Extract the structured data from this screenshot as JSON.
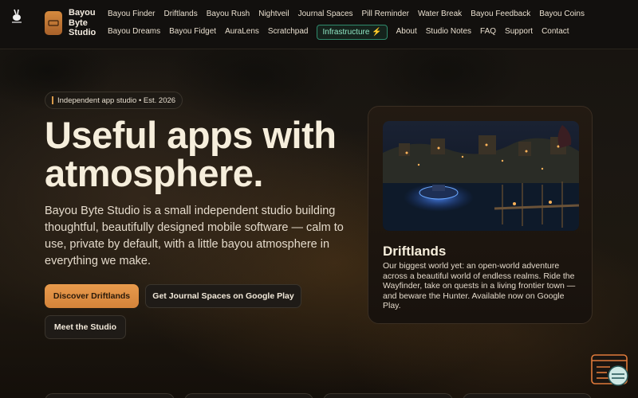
{
  "brand": {
    "name": "Bayou Byte Studio"
  },
  "nav": {
    "row1": [
      "Bayou Finder",
      "Driftlands",
      "Bayou Rush",
      "Nightveil",
      "Journal Spaces",
      "Pill Reminder",
      "Water Break",
      "Bayou Feedback",
      "Bayou Coins"
    ],
    "row2": [
      "Bayou Dreams",
      "Bayou Fidget",
      "AuraLens",
      "Scratchpad"
    ],
    "infrastructure": "Infrastructure ⚡",
    "row2b": [
      "About",
      "Studio Notes",
      "FAQ",
      "Support",
      "Contact"
    ]
  },
  "hero": {
    "pill": "Independent app studio • Est. 2026",
    "title": "Useful apps with atmosphere.",
    "text": "Bayou Byte Studio is a small independent studio building thoughtful, beautifully designed mobile software — calm to use, private by default, with a little bayou atmosphere in everything we make.",
    "primary_button": "Discover Driftlands",
    "secondary_button": "Get Journal Spaces on Google Play",
    "ghost_button": "Meet the Studio"
  },
  "card": {
    "title": "Driftlands",
    "text": "Our biggest world yet: an open-world adventure across a beautiful world of endless realms. Ride the Wayfinder, take on quests in a living frontier town — and beware the Hunter. Available now on Google Play."
  },
  "colors": {
    "accent": "#e0914a",
    "infra": "#8fe6c4",
    "background": "#120f0c"
  }
}
